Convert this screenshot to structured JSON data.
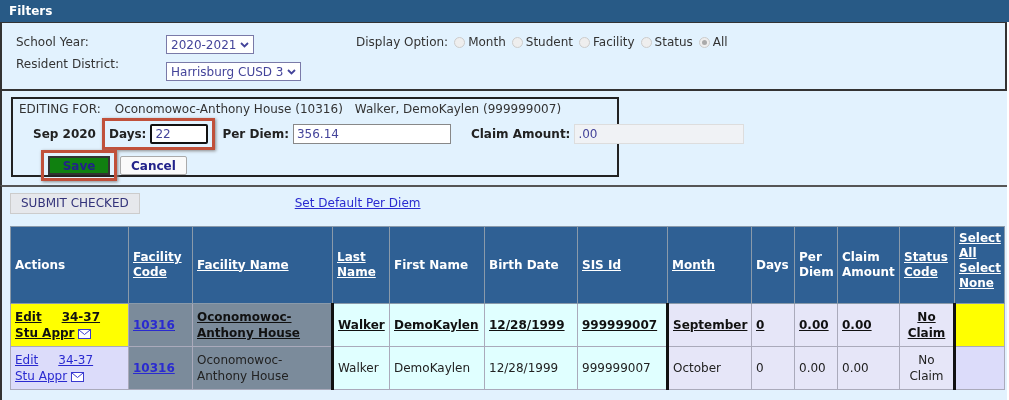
{
  "filters": {
    "title": "Filters",
    "school_year": {
      "label": "School Year:",
      "value": "2020-2021"
    },
    "resident_district": {
      "label": "Resident District:",
      "value": "Harrisburg CUSD 3"
    },
    "display_option": {
      "label": "Display Option:",
      "options": [
        {
          "label": "Month",
          "selected": false
        },
        {
          "label": "Student",
          "selected": false
        },
        {
          "label": "Facility",
          "selected": false
        },
        {
          "label": "Status",
          "selected": false
        },
        {
          "label": "All",
          "selected": true
        }
      ]
    }
  },
  "editing": {
    "label": "EDITING FOR:",
    "facility": "Oconomowoc-Anthony House (10316)",
    "student": "Walker, DemoKaylen (999999007)",
    "period": "Sep 2020",
    "fields": [
      {
        "label": "Days:",
        "value": "22",
        "highlighted": true,
        "readonly": false
      },
      {
        "label": "Per Diem:",
        "value": "356.14",
        "highlighted": false,
        "readonly": false
      },
      {
        "label": "Claim Amount:",
        "value": ".00",
        "highlighted": false,
        "readonly": true
      }
    ],
    "buttons": [
      {
        "label": "Save",
        "kind": "primary",
        "highlighted": true
      },
      {
        "label": "Cancel",
        "kind": "secondary",
        "highlighted": false
      }
    ]
  },
  "toolbar": {
    "submit": "SUBMIT CHECKED",
    "link": "Set Default Per Diem"
  },
  "table": {
    "actions_column": "Actions",
    "columns": [
      {
        "label": "Facility Code",
        "link": true
      },
      {
        "label": "Facility Name",
        "link": true
      },
      {
        "label": "Last Name",
        "link": true
      },
      {
        "label": "First Name",
        "link": false
      },
      {
        "label": "Birth Date",
        "link": false
      },
      {
        "label": "SIS Id",
        "link": true
      },
      {
        "label": "Month",
        "link": true
      },
      {
        "label": "Days",
        "link": false
      },
      {
        "label": "Per Diem",
        "link": false
      },
      {
        "label": "Claim Amount",
        "link": false
      },
      {
        "label": "Status Code",
        "link": true
      }
    ],
    "select_links": [
      "Select All",
      "Select None"
    ],
    "rows": [
      {
        "selected": true,
        "actions": [
          "Edit",
          "34-37",
          "Stu Appr"
        ],
        "cells": [
          "10316",
          "Oconomowoc-Anthony House",
          "Walker",
          "DemoKaylen",
          "12/28/1999",
          "999999007",
          "September",
          "0",
          "0.00",
          "0.00",
          "No Claim"
        ]
      },
      {
        "selected": false,
        "actions": [
          "Edit",
          "34-37",
          "Stu Appr"
        ],
        "cells": [
          "10316",
          "Oconomowoc-Anthony House",
          "Walker",
          "DemoKaylen",
          "12/28/1999",
          "999999007",
          "October",
          "0",
          "0.00",
          "0.00",
          "No Claim"
        ]
      }
    ]
  }
}
